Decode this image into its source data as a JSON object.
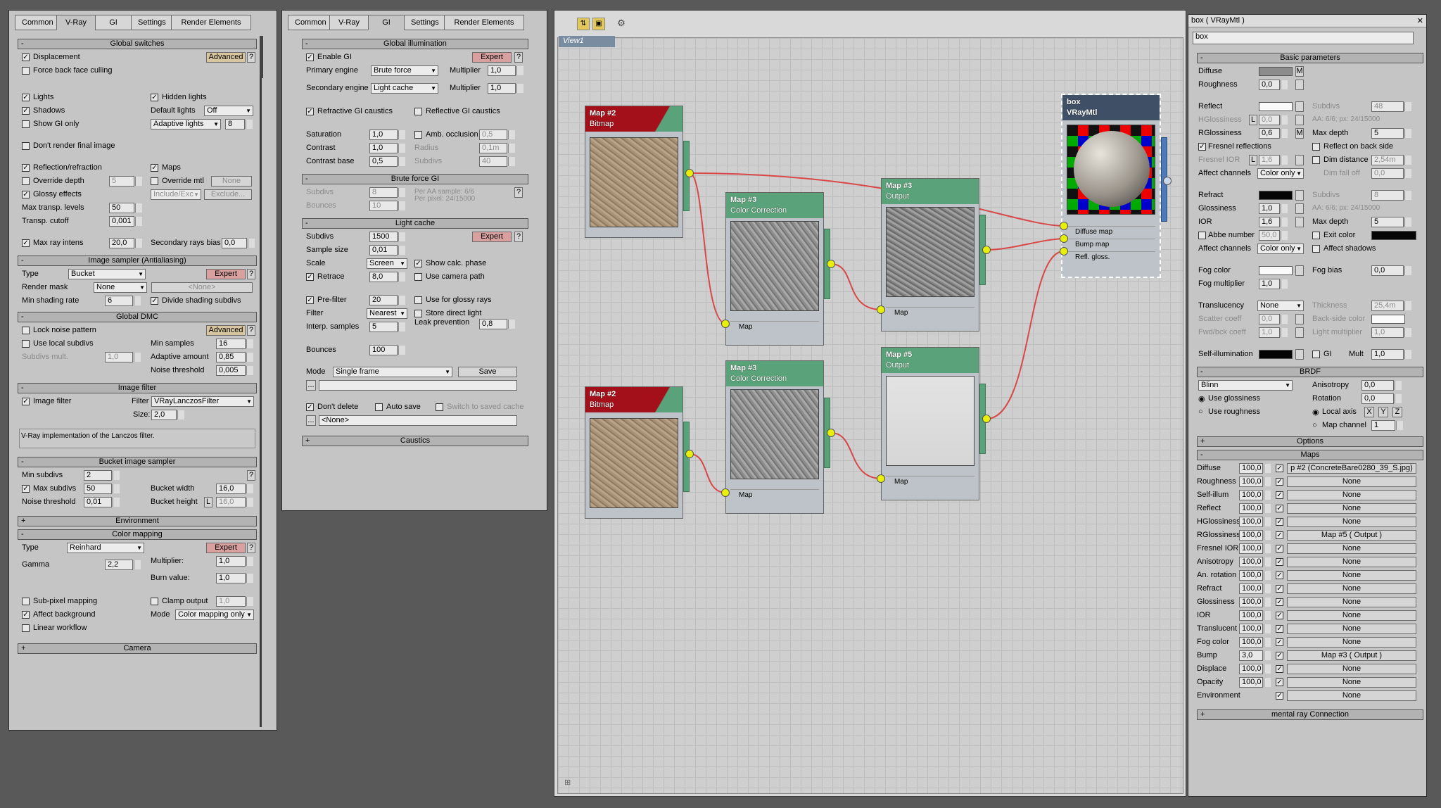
{
  "render_setup": {
    "tabs": [
      "Common",
      "V-Ray",
      "GI",
      "Settings",
      "Render Elements"
    ],
    "global_switches": {
      "title": "Global switches",
      "displacement": "Displacement",
      "advanced": "Advanced",
      "q": "?",
      "force_back": "Force back face culling",
      "lights": "Lights",
      "hidden_lights": "Hidden lights",
      "shadows": "Shadows",
      "default_lights": "Default lights",
      "default_lights_val": "Off",
      "show_gi_only": "Show GI only",
      "adaptive_lights": "Adaptive lights",
      "adaptive_val": "8",
      "dont_render": "Don't render final image",
      "refl_refr": "Reflection/refraction",
      "maps": "Maps",
      "override_depth": "Override depth",
      "override_depth_val": "5",
      "override_mtl": "Override mtl",
      "none": "None",
      "glossy": "Glossy effects",
      "include_exc": "Include/Exc",
      "exclude": "Exclude...",
      "max_transp": "Max transp. levels",
      "max_transp_val": "50",
      "transp_cutoff": "Transp. cutoff",
      "transp_cutoff_val": "0,001",
      "max_ray": "Max ray intens",
      "max_ray_val": "20,0",
      "sec_rays": "Secondary rays bias",
      "sec_rays_val": "0,0"
    },
    "image_sampler": {
      "title": "Image sampler (Antialiasing)",
      "type": "Type",
      "type_val": "Bucket",
      "expert": "Expert",
      "render_mask": "Render mask",
      "render_mask_val": "None",
      "none_btn": "<None>",
      "min_shading": "Min shading rate",
      "min_shading_val": "6",
      "divide": "Divide shading subdivs"
    },
    "global_dmc": {
      "title": "Global DMC",
      "lock": "Lock noise pattern",
      "advanced": "Advanced",
      "use_local": "Use local subdivs",
      "min_samples": "Min samples",
      "min_samples_val": "16",
      "subdivs_mult": "Subdivs mult.",
      "subdivs_mult_val": "1,0",
      "adaptive": "Adaptive amount",
      "adaptive_val": "0,85",
      "noise": "Noise threshold",
      "noise_val": "0,005"
    },
    "image_filter": {
      "title": "Image filter",
      "label": "Image filter",
      "filter": "Filter",
      "filter_val": "VRayLanczosFilter",
      "size": "Size:",
      "size_val": "2,0",
      "desc": "V-Ray implementation of the Lanczos filter."
    },
    "bucket": {
      "title": "Bucket image sampler",
      "min_subdivs": "Min subdivs",
      "min_subdivs_val": "2",
      "max_subdivs": "Max subdivs",
      "max_subdivs_val": "50",
      "bucket_width": "Bucket width",
      "bucket_width_val": "16,0",
      "noise": "Noise threshold",
      "noise_val": "0,01",
      "bucket_height": "Bucket height",
      "L": "L",
      "bucket_height_val": "16,0"
    },
    "environment": "Environment",
    "color_mapping": {
      "title": "Color mapping",
      "type": "Type",
      "type_val": "Reinhard",
      "expert": "Expert",
      "multiplier": "Multiplier:",
      "multiplier_val": "1,0",
      "gamma": "Gamma",
      "gamma_val": "2,2",
      "burn": "Burn value:",
      "burn_val": "1,0",
      "subpixel": "Sub-pixel mapping",
      "clamp": "Clamp output",
      "clamp_val": "1,0",
      "affect_bg": "Affect background",
      "mode": "Mode",
      "mode_val": "Color mapping only",
      "linear": "Linear workflow"
    },
    "camera": "Camera"
  },
  "gi_panel": {
    "tabs": [
      "Common",
      "V-Ray",
      "GI",
      "Settings",
      "Render Elements"
    ],
    "gi": {
      "title": "Global illumination",
      "enable": "Enable GI",
      "expert": "Expert",
      "primary": "Primary engine",
      "primary_val": "Brute force",
      "multiplier": "Multiplier",
      "mult1": "1,0",
      "secondary": "Secondary engine",
      "secondary_val": "Light cache",
      "mult2": "1,0",
      "refr_caustics": "Refractive GI caustics",
      "refl_caustics": "Reflective GI caustics",
      "saturation": "Saturation",
      "saturation_val": "1,0",
      "amb": "Amb. occlusion",
      "amb_val": "0,5",
      "contrast": "Contrast",
      "contrast_val": "1,0",
      "radius": "Radius",
      "radius_val": "0,1m",
      "contrast_base": "Contrast base",
      "contrast_base_val": "0,5",
      "subdivs": "Subdivs",
      "subdivs_val": "40"
    },
    "brute": {
      "title": "Brute force GI",
      "subdivs": "Subdivs",
      "subdivs_val": "8",
      "per_aa": "Per AA sample: 6/6",
      "per_pixel": "Per pixel: 24/15000",
      "bounces": "Bounces",
      "bounces_val": "10"
    },
    "lc": {
      "title": "Light cache",
      "subdivs": "Subdivs",
      "subdivs_val": "1500",
      "expert": "Expert",
      "sample_size": "Sample size",
      "sample_size_val": "0,01",
      "scale": "Scale",
      "scale_val": "Screen",
      "show_calc": "Show calc. phase",
      "retrace": "Retrace",
      "retrace_val": "8,0",
      "use_camera": "Use camera path",
      "prefilter": "Pre-filter",
      "prefilter_val": "20",
      "use_glossy": "Use for glossy rays",
      "filter": "Filter",
      "filter_val": "Nearest",
      "store_direct": "Store direct light",
      "interp": "Interp. samples",
      "interp_val": "5",
      "leak": "Leak prevention",
      "leak_val": "0,8",
      "bounces": "Bounces",
      "bounces_val": "100",
      "mode": "Mode",
      "mode_val": "Single frame",
      "save": "Save",
      "dots": "...",
      "dont_delete": "Don't delete",
      "auto_save": "Auto save",
      "switch_saved": "Switch to saved cache",
      "none": "<None>"
    },
    "caustics": "Caustics"
  },
  "node_editor": {
    "view_tab": "View1",
    "nodes": {
      "bitmap1": {
        "title": "Map #2",
        "subtitle": "Bitmap"
      },
      "cc1": {
        "title": "Map #3",
        "subtitle": "Color Correction",
        "port": "Map"
      },
      "out1": {
        "title": "Map #3",
        "subtitle": "Output",
        "port": "Map"
      },
      "bitmap2": {
        "title": "Map #2",
        "subtitle": "Bitmap"
      },
      "cc2": {
        "title": "Map #3",
        "subtitle": "Color Correction",
        "port": "Map"
      },
      "out2": {
        "title": "Map #5",
        "subtitle": "Output",
        "port": "Map"
      },
      "mtl": {
        "title": "box",
        "subtitle": "VRayMtl",
        "slots": [
          "Diffuse map",
          "Bump map",
          "Refl. gloss."
        ]
      }
    }
  },
  "material": {
    "window_title": "box  ( VRayMtl )",
    "name": "box",
    "basic": {
      "title": "Basic parameters",
      "diffuse": "Diffuse",
      "M": "M",
      "roughness": "Roughness",
      "roughness_val": "0,0",
      "reflect": "Reflect",
      "subdivs": "Subdivs",
      "subdivs_val": "48",
      "hgloss": "HGlossiness",
      "L": "L",
      "hgloss_val": "0,0",
      "aa1": "AA: 6/6; px: 24/15000",
      "rgloss": "RGlossiness",
      "rgloss_val": "0,6",
      "max_depth": "Max depth",
      "max_depth_val": "5",
      "fresnel": "Fresnel reflections",
      "reflect_back": "Reflect on back side",
      "fresnel_ior": "Fresnel IOR",
      "fresnel_ior_val": "1,6",
      "dim_dist": "Dim distance",
      "dim_dist_val": "2,54m",
      "dim_fall": "Dim fall off",
      "dim_fall_val": "0,0",
      "affect_ch": "Affect channels",
      "affect_ch_val": "Color only",
      "refract": "Refract",
      "r_subdivs": "Subdivs",
      "r_subdivs_val": "8",
      "glossiness": "Glossiness",
      "glossiness_val": "1,0",
      "aa2": "AA: 6/6; px: 24/15000",
      "ior": "IOR",
      "ior_val": "1,6",
      "r_max_depth": "Max depth",
      "r_max_depth_val": "5",
      "abbe": "Abbe number",
      "abbe_val": "50,0",
      "exit_color": "Exit color",
      "r_affect_ch": "Affect channels",
      "r_affect_ch_val": "Color only",
      "affect_shadows": "Affect shadows",
      "fog_color": "Fog color",
      "fog_bias": "Fog bias",
      "fog_bias_val": "0,0",
      "fog_mult": "Fog multiplier",
      "fog_mult_val": "1,0",
      "translucency": "Translucency",
      "translucency_val": "None",
      "thickness": "Thickness",
      "thickness_val": "25,4m",
      "scatter": "Scatter coeff",
      "scatter_val": "0,0",
      "backside": "Back-side color",
      "fwdbck": "Fwd/bck coeff",
      "fwdbck_val": "1,0",
      "light_mult": "Light multiplier",
      "light_mult_val": "1,0",
      "self_illum": "Self-illumination",
      "gi": "GI",
      "mult": "Mult",
      "mult_val": "1,0"
    },
    "brdf": {
      "title": "BRDF",
      "type_val": "Blinn",
      "anisotropy": "Anisotropy",
      "anisotropy_val": "0,0",
      "rotation": "Rotation",
      "rotation_val": "0,0",
      "use_gloss": "Use glossiness",
      "use_rough": "Use roughness",
      "local_axis": "Local axis",
      "X": "X",
      "Y": "Y",
      "Z": "Z",
      "map_channel": "Map channel",
      "map_channel_val": "1"
    },
    "options": "Options",
    "maps_title": "Maps",
    "maps": [
      {
        "name": "Diffuse",
        "amount": "100,0",
        "map": "p #2 (ConcreteBare0280_39_S.jpg)"
      },
      {
        "name": "Roughness",
        "amount": "100,0",
        "map": "None"
      },
      {
        "name": "Self-illum",
        "amount": "100,0",
        "map": "None"
      },
      {
        "name": "Reflect",
        "amount": "100,0",
        "map": "None"
      },
      {
        "name": "HGlossiness",
        "amount": "100,0",
        "map": "None"
      },
      {
        "name": "RGlossiness",
        "amount": "100,0",
        "map": "Map #5  ( Output )"
      },
      {
        "name": "Fresnel IOR",
        "amount": "100,0",
        "map": "None"
      },
      {
        "name": "Anisotropy",
        "amount": "100,0",
        "map": "None"
      },
      {
        "name": "An. rotation",
        "amount": "100,0",
        "map": "None"
      },
      {
        "name": "Refract",
        "amount": "100,0",
        "map": "None"
      },
      {
        "name": "Glossiness",
        "amount": "100,0",
        "map": "None"
      },
      {
        "name": "IOR",
        "amount": "100,0",
        "map": "None"
      },
      {
        "name": "Translucent",
        "amount": "100,0",
        "map": "None"
      },
      {
        "name": "Fog color",
        "amount": "100,0",
        "map": "None"
      },
      {
        "name": "Bump",
        "amount": "3,0",
        "map": "Map #3  ( Output )"
      },
      {
        "name": "Displace",
        "amount": "100,0",
        "map": "None"
      },
      {
        "name": "Opacity",
        "amount": "100,0",
        "map": "None"
      },
      {
        "name": "Environment",
        "amount": "",
        "map": "None"
      }
    ],
    "mental_ray": "mental ray Connection"
  }
}
